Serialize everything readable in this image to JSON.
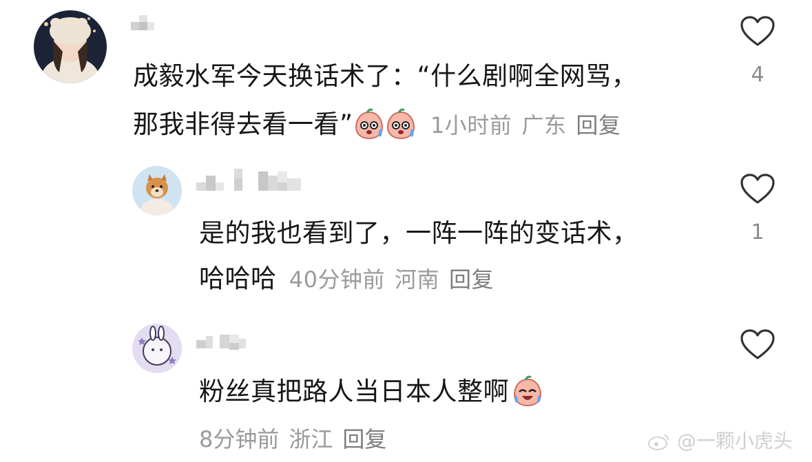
{
  "comments": [
    {
      "text_line1": "成毅水军今天换话术了：“什么剧啊全网骂，",
      "text_line2": "那我非得去看一看”",
      "time": "1小时前",
      "location": "广东",
      "reply_label": "回复",
      "likes": "4",
      "emoji": [
        "sweat-peach-emoji",
        "sweat-peach-emoji"
      ]
    },
    {
      "text_line1": "是的我也看到了，一阵一阵的变话术，",
      "text_line2": "哈哈哈",
      "time": "40分钟前",
      "location": "河南",
      "reply_label": "回复",
      "likes": "1"
    },
    {
      "text_line1": "粉丝真把路人当日本人整啊",
      "time": "8分钟前",
      "location": "浙江",
      "reply_label": "回复",
      "emoji": [
        "laugh-cry-peach-emoji"
      ]
    }
  ],
  "watermark": {
    "platform_icon": "weibo-icon",
    "text": "@一颗小虎头"
  }
}
